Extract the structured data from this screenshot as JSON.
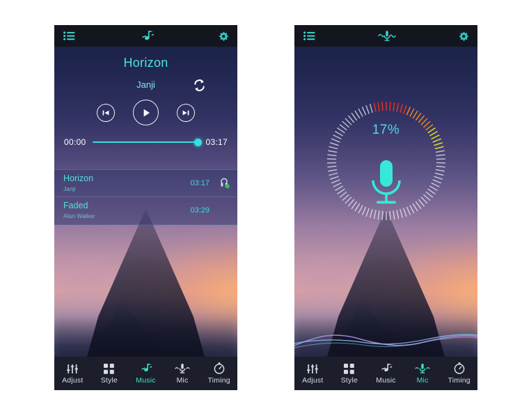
{
  "colors": {
    "accent_cyan": "#4ae3dc",
    "accent_active": "#3fe0c9",
    "progress": "#35dfe0",
    "nav_bg": "#1c1f2b",
    "topbar_bg": "#14161f",
    "playlist_bg": "#2e3268",
    "meter_red": "#e8322a",
    "meter_orange": "#ef8a22",
    "meter_yellow": "#e8e320",
    "meter_white": "#e9eef5",
    "dot_green": "#2fc84f"
  },
  "left_panel": {
    "topbar": {
      "menu_icon": "list-lines-icon",
      "center_icon": "music-note-icon",
      "settings_icon": "gear-icon"
    },
    "now_playing": {
      "title": "Horizon",
      "artist": "Janji",
      "repeat_icon": "repeat-icon",
      "prev_icon": "skip-previous-icon",
      "play_icon": "play-icon",
      "next_icon": "skip-next-icon",
      "elapsed": "00:00",
      "duration": "03:17",
      "progress_percent": 100
    },
    "playlist": [
      {
        "title": "Horizon",
        "artist": "Janji",
        "duration": "03:17",
        "icon": "speaker-playing-icon",
        "playing": true
      },
      {
        "title": "Faded",
        "artist": "Alan Walker",
        "duration": "03:29",
        "icon": "",
        "playing": false
      }
    ],
    "nav": {
      "items": [
        {
          "label": "Adjust",
          "icon": "sliders-icon",
          "active": false
        },
        {
          "label": "Style",
          "icon": "grid-icon",
          "active": false
        },
        {
          "label": "Music",
          "icon": "music-note-icon",
          "active": true
        },
        {
          "label": "Mic",
          "icon": "microphone-icon",
          "active": false
        },
        {
          "label": "Timing",
          "icon": "stopwatch-icon",
          "active": false
        }
      ]
    }
  },
  "right_panel": {
    "topbar": {
      "menu_icon": "list-lines-icon",
      "center_icon": "microphone-waves-icon",
      "settings_icon": "gear-icon"
    },
    "mic_dial": {
      "value_label": "17%",
      "value": 17,
      "mic_icon": "microphone-icon",
      "total_ticks": 90,
      "colored_ticks": 23
    },
    "waveform": "audio-waveform",
    "nav": {
      "items": [
        {
          "label": "Adjust",
          "icon": "sliders-icon",
          "active": false
        },
        {
          "label": "Style",
          "icon": "grid-icon",
          "active": false
        },
        {
          "label": "Music",
          "icon": "music-note-icon",
          "active": false
        },
        {
          "label": "Mic",
          "icon": "microphone-icon",
          "active": true
        },
        {
          "label": "Timing",
          "icon": "stopwatch-icon",
          "active": false
        }
      ]
    }
  }
}
